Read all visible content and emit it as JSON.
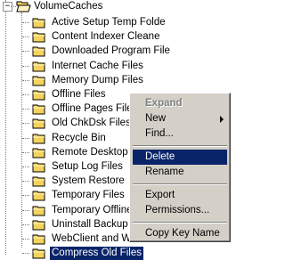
{
  "tree": {
    "root": {
      "label": "VolumeCaches",
      "expander": "−"
    },
    "children": [
      {
        "label": "Active Setup Temp Folde"
      },
      {
        "label": "Content Indexer Cleane"
      },
      {
        "label": "Downloaded Program File"
      },
      {
        "label": "Internet Cache Files"
      },
      {
        "label": "Memory Dump Files"
      },
      {
        "label": "Offline Files"
      },
      {
        "label": "Offline Pages File"
      },
      {
        "label": "Old ChkDsk Files"
      },
      {
        "label": "Recycle Bin"
      },
      {
        "label": "Remote Desktop C"
      },
      {
        "label": "Setup Log Files"
      },
      {
        "label": "System Restore"
      },
      {
        "label": "Temporary Files"
      },
      {
        "label": "Temporary Offline"
      },
      {
        "label": "Uninstall Backup I"
      },
      {
        "label": "WebClient and W"
      },
      {
        "label": "Compress Old Files"
      }
    ]
  },
  "context_menu": {
    "expand": "Expand",
    "new": "New",
    "find": "Find...",
    "delete": "Delete",
    "rename": "Rename",
    "export": "Export",
    "permissions": "Permissions...",
    "copy_key_name": "Copy Key Name"
  },
  "colors": {
    "selection": "#0a246a",
    "menu_bg": "#d4d0c8",
    "folder": "#f4d35c"
  }
}
